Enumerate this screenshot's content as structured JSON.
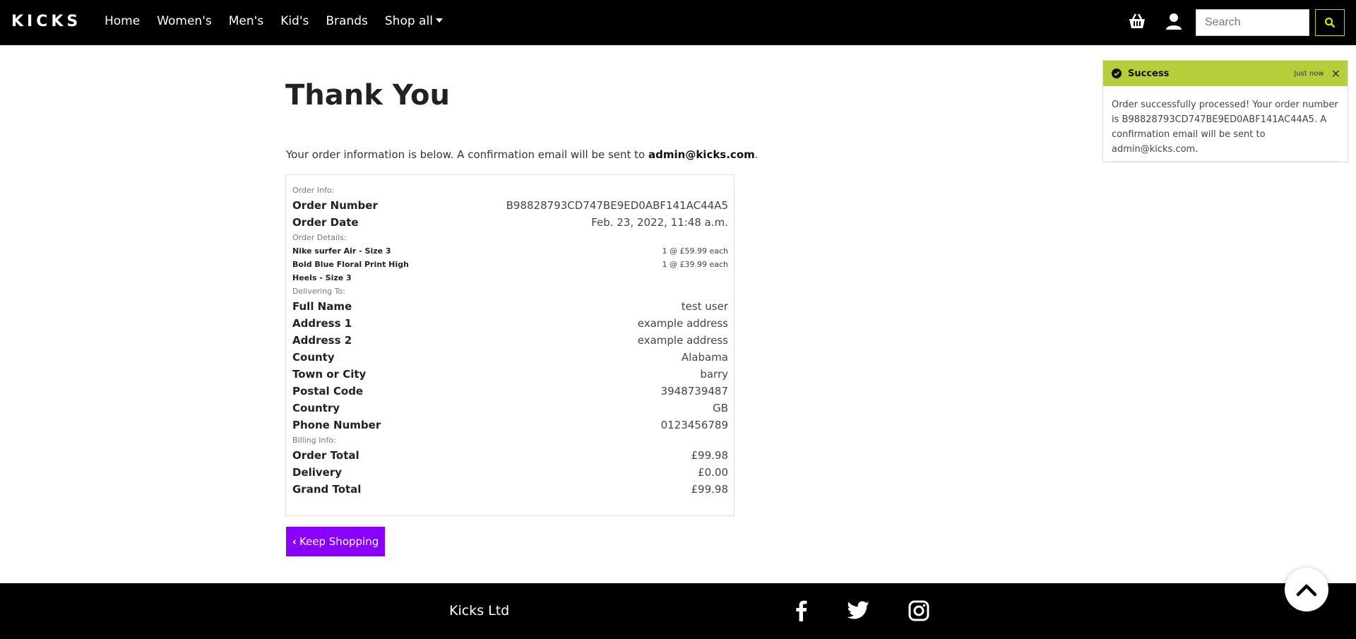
{
  "nav": {
    "brand": "KICKS",
    "links": [
      "Home",
      "Women's",
      "Men's",
      "Kid's",
      "Brands",
      "Shop all"
    ],
    "search_placeholder": "Search"
  },
  "main": {
    "title": "Thank You",
    "intro_text": "Your order information is below. A confirmation email will be sent to ",
    "intro_email": "admin@kicks.com",
    "intro_end": ".",
    "keep_shopping": "Keep Shopping"
  },
  "order": {
    "order_info_label": "Order Info:",
    "order_number_label": "Order Number",
    "order_number": "B98828793CD747BE9ED0ABF141AC44A5",
    "order_date_label": "Order Date",
    "order_date": "Feb. 23, 2022, 11:48 a.m.",
    "order_details_label": "Order Details:",
    "items": [
      {
        "name": "Nike surfer Air - Size 3",
        "price": "1 @ £59.99 each"
      },
      {
        "name": "Bold Blue Floral Print High Heels - Size 3",
        "price": "1 @ £39.99 each"
      }
    ],
    "delivering_label": "Delivering To:",
    "delivery": [
      {
        "label": "Full Name",
        "value": "test user"
      },
      {
        "label": "Address 1",
        "value": "example address"
      },
      {
        "label": "Address 2",
        "value": "example address"
      },
      {
        "label": "County",
        "value": "Alabama"
      },
      {
        "label": "Town or City",
        "value": "barry"
      },
      {
        "label": "Postal Code",
        "value": "3948739487"
      },
      {
        "label": "Country",
        "value": "GB"
      },
      {
        "label": "Phone Number",
        "value": "0123456789"
      }
    ],
    "billing_label": "Billing Info:",
    "billing": [
      {
        "label": "Order Total",
        "value": "£99.98"
      },
      {
        "label": "Delivery",
        "value": "£0.00"
      },
      {
        "label": "Grand Total",
        "value": "£99.98"
      }
    ]
  },
  "toast": {
    "title": "Success",
    "time": "Just now",
    "message": "Order successfully processed! Your order number is B98828793CD747BE9ED0ABF141AC44A5. A confirmation email will be sent to admin@kicks.com.",
    "color": "#b4cf3a"
  },
  "footer": {
    "text": "Kicks Ltd",
    "icons": [
      "facebook-icon",
      "twitter-icon",
      "instagram-icon"
    ]
  },
  "colors": {
    "accent": "#8a00ff",
    "toast_header": "#b4cf3a",
    "nav_bg": "#000000"
  }
}
